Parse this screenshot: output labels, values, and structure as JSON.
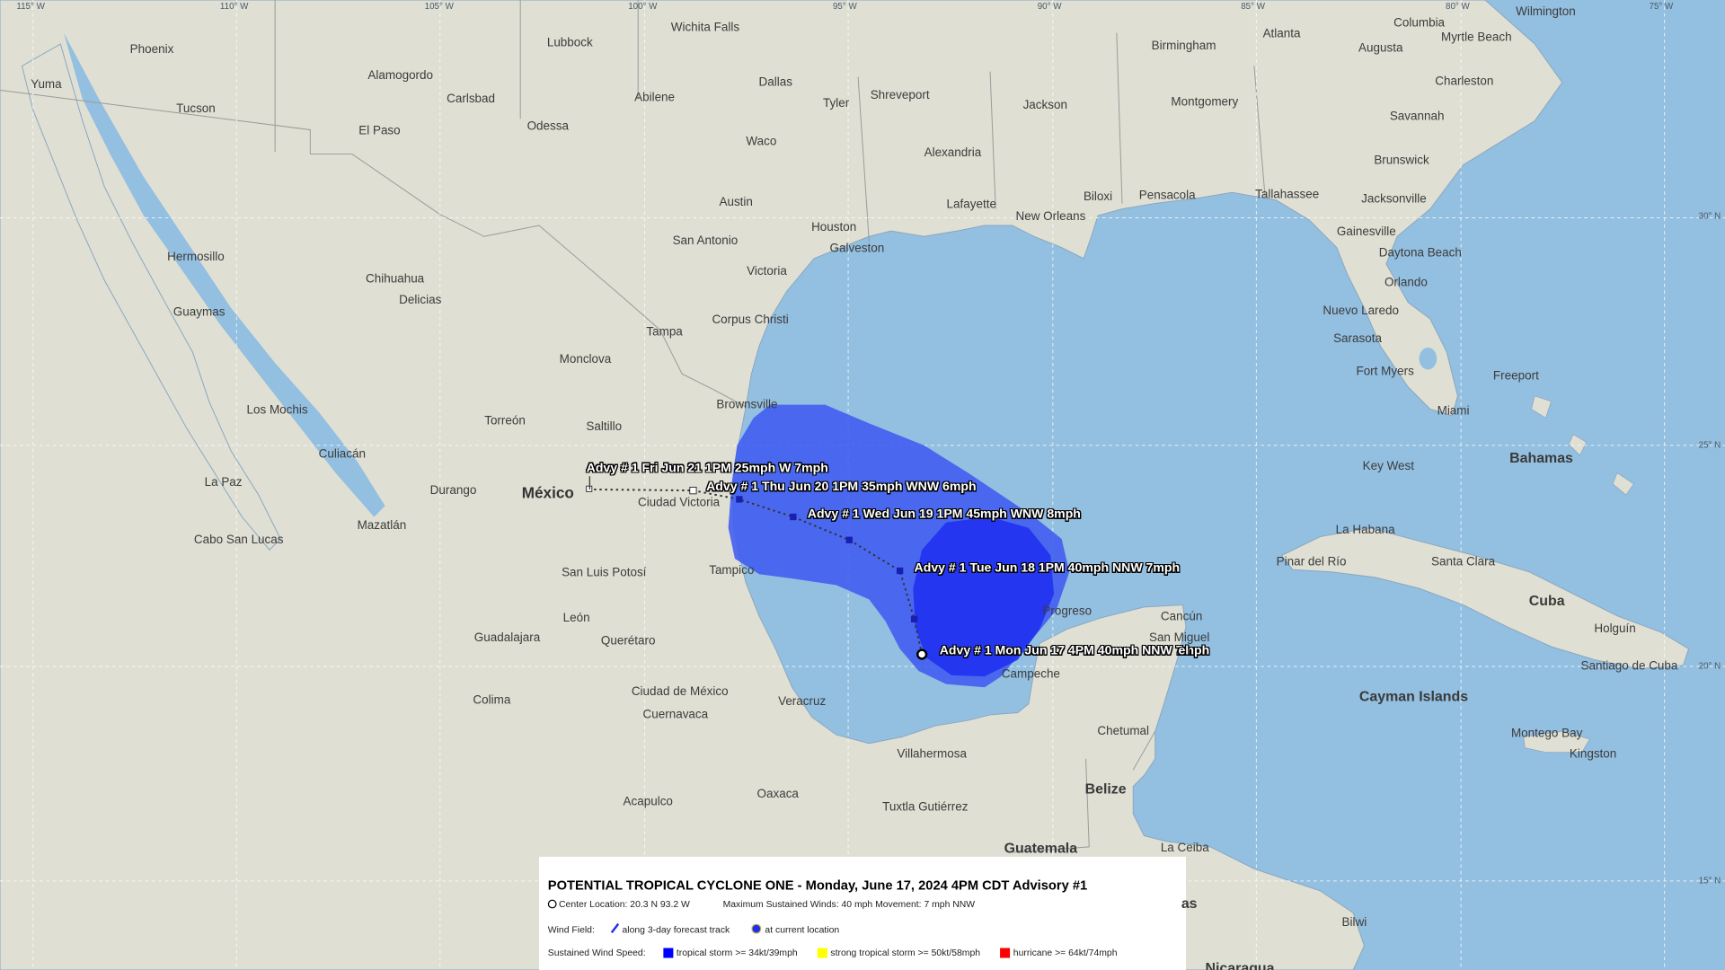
{
  "map": {
    "water_color": "#93bfe0",
    "land_color": "#dfdfd4",
    "grid": {
      "longitudes": [
        "115° W",
        "110° W",
        "105° W",
        "100° W",
        "95° W",
        "90° W",
        "85° W",
        "80° W",
        "75° W"
      ],
      "latitudes": [
        "30° N",
        "25° N",
        "20° N",
        "15° N"
      ]
    },
    "cities": [
      "Phoenix",
      "Yuma",
      "Tucson",
      "Alamogordo",
      "Lubbock",
      "Wichita Falls",
      "Carlsbad",
      "Abilene",
      "Dallas",
      "Tyler",
      "Shreveport",
      "El Paso",
      "Odessa",
      "Waco",
      "Jackson",
      "Birmingham",
      "Atlanta",
      "Columbia",
      "Wilmington",
      "Augusta",
      "Myrtle Beach",
      "Montgomery",
      "Charleston",
      "Savannah",
      "Alexandria",
      "Austin",
      "Lafayette",
      "Biloxi",
      "Pensacola",
      "Tallahassee",
      "Brunswick",
      "Jacksonville",
      "Houston",
      "New Orleans",
      "Galveston",
      "San Antonio",
      "Victoria",
      "Gainesville",
      "Daytona Beach",
      "Hermosillo",
      "Chihuahua",
      "Delicias",
      "Orlando",
      "Guaymas",
      "Corpus Christi",
      "Tampa",
      "Nuevo Laredo",
      "Sarasota",
      "Monclova",
      "Fort Myers",
      "Freeport",
      "Los Mochis",
      "Torreón",
      "Saltillo",
      "Brownsville",
      "Miami",
      "Culiacán",
      "Key West",
      "La Paz",
      "Durango",
      "Ciudad Victoria",
      "La Habana",
      "Mazatlán",
      "Cabo San Lucas",
      "Pinar del Río",
      "Santa Clara",
      "San Luis Potosí",
      "Tampico",
      "Progreso",
      "León",
      "Guadalajara",
      "Cancún",
      "Holguín",
      "Querétaro",
      "San Miguel",
      "Campeche",
      "Santiago de Cuba",
      "Colima",
      "Ciudad de México",
      "Veracruz",
      "Cuernavaca",
      "Chetumal",
      "Montego Bay",
      "Kingston",
      "Villahermosa",
      "Oaxaca",
      "Tuxtla Gutiérrez",
      "Acapulco",
      "La Ceiba",
      "Bilwi"
    ],
    "countries": [
      "México",
      "Bahamas",
      "Cuba",
      "Cayman Islands",
      "Belize",
      "Guatemala",
      "Nicaragua"
    ]
  },
  "storm": {
    "cone_color": "#3f5cf0",
    "current_wind_color": "#1f2ef0",
    "track_points": [
      {
        "label": "Advy # 1 Mon Jun 17 4PM 40mph NNW 7mph",
        "lat": 20.3,
        "lon": -93.2
      },
      {
        "label": "Advy # 1 Tue Jun 18 1PM 40mph NNW 7mph"
      },
      {
        "label": "Advy # 1 Wed Jun 19 1PM 45mph WNW 8mph"
      },
      {
        "label": "Advy # 1 Thu Jun 20 1PM 35mph WNW 6mph"
      },
      {
        "label": "Advy # 1 Fri Jun 21 1PM 25mph W 7mph"
      }
    ],
    "overlap_fragment": "el"
  },
  "legend": {
    "title": "POTENTIAL TROPICAL CYCLONE ONE  -   Monday, June 17, 2024 4PM CDT  Advisory #1",
    "center_location": "Center Location: 20.3 N 93.2 W",
    "max_winds": "Maximum Sustained Winds: 40 mph Movement: 7 mph NNW",
    "wind_field_label": "Wind Field:",
    "along_track": "along 3-day forecast track",
    "at_current": "at current location",
    "speed_label": "Sustained Wind Speed:",
    "categories": [
      {
        "label": "tropical storm >= 34kt/39mph",
        "color": "#0000ff"
      },
      {
        "label": "strong tropical storm >= 50kt/58mph",
        "color": "#ffff00"
      },
      {
        "label": "hurricane >= 64kt/74mph",
        "color": "#ff0000"
      }
    ],
    "partial_city": "as"
  }
}
